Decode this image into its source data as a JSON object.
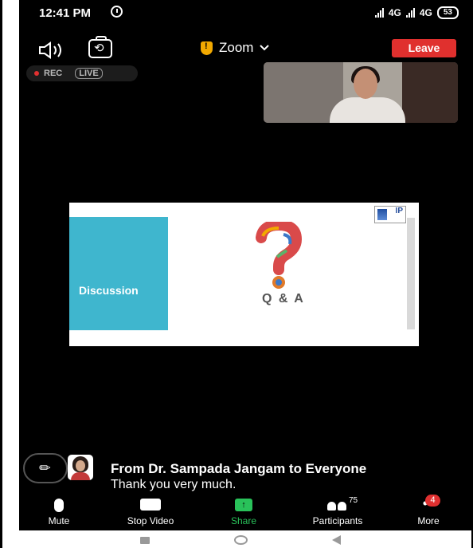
{
  "status_bar": {
    "time": "12:41 PM",
    "network_left": "4G",
    "network_right": "4G",
    "battery": "53"
  },
  "toolbar": {
    "meeting_title": "Zoom",
    "leave_label": "Leave"
  },
  "recording": {
    "rec_label": "REC",
    "live_label": "LIVE"
  },
  "slide": {
    "section_label": "Discussion",
    "heading": "Q & A",
    "logo_text": "IP"
  },
  "chat": {
    "from_text": "From Dr. Sampada Jangam to Everyone",
    "message": "Thank you very much."
  },
  "bottom_toolbar": {
    "mute_label": "Mute",
    "stop_video_label": "Stop Video",
    "share_label": "Share",
    "participants_label": "Participants",
    "participants_count": "75",
    "more_label": "More",
    "more_badge": "4"
  },
  "colors": {
    "leave": "#e0302e",
    "share": "#29c25a",
    "slide_band": "#3fb6ce",
    "security_shield": "#f2a900"
  }
}
